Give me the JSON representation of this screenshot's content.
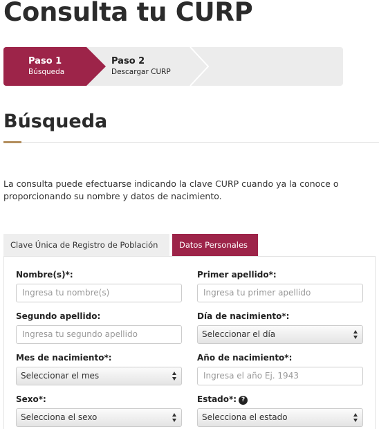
{
  "page": {
    "title": "Consulta tu CURP"
  },
  "stepper": {
    "steps": [
      {
        "number": "Paso 1",
        "description": "Búsqueda"
      },
      {
        "number": "Paso 2",
        "description": "Descargar CURP"
      }
    ]
  },
  "section": {
    "title": "Búsqueda",
    "intro": "La consulta puede efectuarse indicando la clave CURP cuando ya la conoce o proporcionando su nombre y datos de nacimiento."
  },
  "tabs": {
    "items": [
      {
        "label": "Clave Única de Registro de Población",
        "active": false
      },
      {
        "label": "Datos Personales",
        "active": true
      }
    ]
  },
  "form": {
    "nombre": {
      "label": "Nombre(s)*:",
      "placeholder": "Ingresa tu nombre(s)"
    },
    "primer_apellido": {
      "label": "Primer apellido*:",
      "placeholder": "Ingresa tu primer apellido"
    },
    "segundo_apellido": {
      "label": "Segundo apellido:",
      "placeholder": "Ingresa tu segundo apellido"
    },
    "dia": {
      "label": "Día de nacimiento*:",
      "selected": "Seleccionar el día"
    },
    "mes": {
      "label": "Mes de nacimiento*:",
      "selected": "Seleccionar el mes"
    },
    "anio": {
      "label": "Año de nacimiento*:",
      "placeholder": "Ingresa el año Ej. 1943"
    },
    "sexo": {
      "label": "Sexo*:",
      "selected": "Selecciona el sexo"
    },
    "estado": {
      "label": "Estado*:",
      "selected": "Selecciona el estado"
    }
  },
  "icons": {
    "help": "question-circle-icon",
    "select_arrows": "updown-arrows-icon"
  },
  "colors": {
    "accent": "#9d2449",
    "gold": "#b38e5d",
    "stepper_bg": "#ececec"
  }
}
